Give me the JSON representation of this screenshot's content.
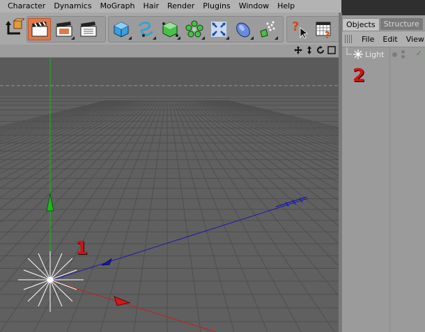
{
  "menu": [
    "Character",
    "Dynamics",
    "MoGraph",
    "Hair",
    "Render",
    "Plugins",
    "Window",
    "Help"
  ],
  "object_manager": {
    "tabs": [
      "Objects",
      "Structure"
    ],
    "menu": [
      "File",
      "Edit",
      "View"
    ],
    "objects": [
      {
        "name": "Light",
        "check": "✓"
      }
    ]
  },
  "annotations": [
    "1",
    "2"
  ],
  "colors": {
    "active_tool": "#e0784a",
    "axis_x": "#cc1a1a",
    "axis_y": "#22b322",
    "axis_z": "#1a1aa8",
    "callout": "#cc1414"
  },
  "icons": {
    "viewport_nav": [
      "move-view-icon",
      "zoom-view-icon",
      "rotate-view-icon",
      "maximize-view-icon"
    ]
  }
}
